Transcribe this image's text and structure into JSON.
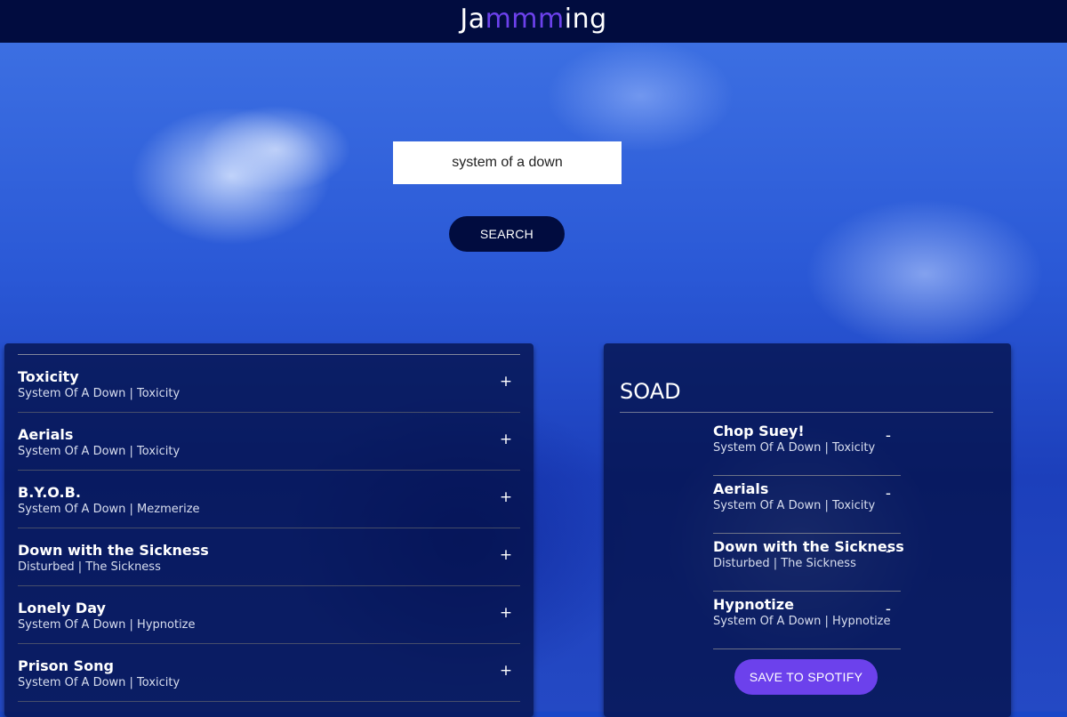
{
  "app": {
    "logo_prefix": "Ja",
    "logo_accent": "mmm",
    "logo_suffix": "ing",
    "accent_color": "#6c41ec",
    "header_color": "#010c3f"
  },
  "search": {
    "value": "system of a down",
    "button_label": "SEARCH"
  },
  "results": {
    "tracks": [
      {
        "name": "Toxicity",
        "info": "System Of A Down | Toxicity",
        "action": "+"
      },
      {
        "name": "Aerials",
        "info": "System Of A Down | Toxicity",
        "action": "+"
      },
      {
        "name": "B.Y.O.B.",
        "info": "System Of A Down | Mezmerize",
        "action": "+"
      },
      {
        "name": "Down with the Sickness",
        "info": "Disturbed | The Sickness",
        "action": "+"
      },
      {
        "name": "Lonely Day",
        "info": "System Of A Down | Hypnotize",
        "action": "+"
      },
      {
        "name": "Prison Song",
        "info": "System Of A Down | Toxicity",
        "action": "+"
      }
    ]
  },
  "playlist": {
    "name": "SOAD",
    "tracks": [
      {
        "name": "Chop Suey!",
        "info": "System Of A Down | Toxicity",
        "action": "-"
      },
      {
        "name": "Aerials",
        "info": "System Of A Down | Toxicity",
        "action": "-"
      },
      {
        "name": "Down with the Sickness",
        "info": "Disturbed | The Sickness",
        "action": "-"
      },
      {
        "name": "Hypnotize",
        "info": "System Of A Down | Hypnotize",
        "action": "-"
      }
    ],
    "save_label": "SAVE TO SPOTIFY"
  }
}
